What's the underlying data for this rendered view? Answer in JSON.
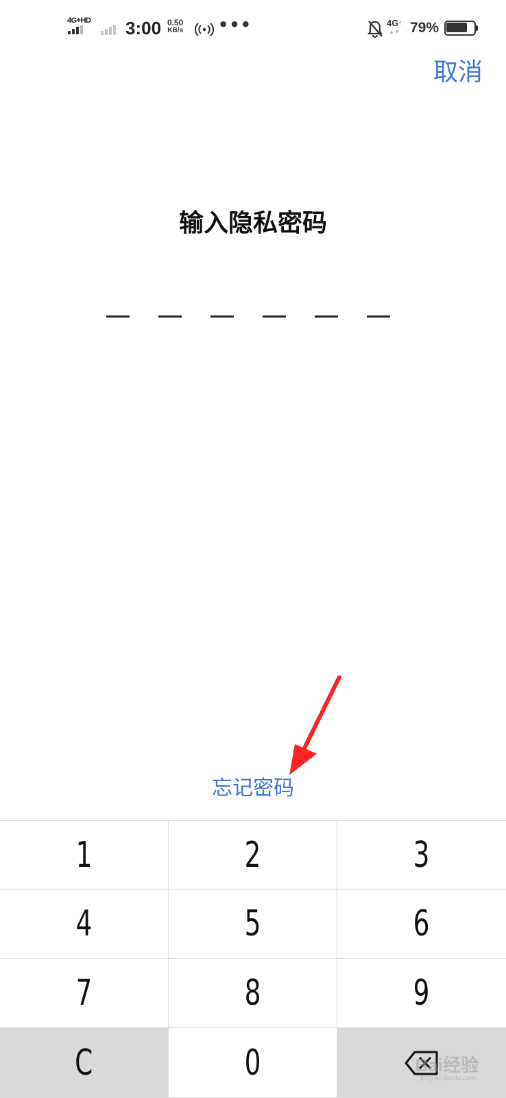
{
  "status_bar": {
    "network_label": "4G+HD",
    "time": "3:00",
    "speed_value": "0.50",
    "speed_unit": "KB/s",
    "more": "•••",
    "network2": "4G",
    "battery_percent": "79%",
    "battery_level": 0.79,
    "icons": [
      "signal-icon",
      "signal-weak-icon",
      "hotspot-icon",
      "mute-icon",
      "battery-icon"
    ]
  },
  "header": {
    "cancel_label": "取消"
  },
  "main": {
    "title": "输入隐私密码",
    "pin_length": 6,
    "forgot_label": "忘记密码"
  },
  "keypad": {
    "keys": [
      "1",
      "2",
      "3",
      "4",
      "5",
      "6",
      "7",
      "8",
      "9",
      "C",
      "0"
    ],
    "backspace_icon": "backspace-icon"
  },
  "watermark": {
    "brand": "Bai经验",
    "url": "jingyan.baidu.com"
  },
  "colors": {
    "accent": "#3f77cf",
    "annotation_arrow": "#ff2222",
    "function_key_bg": "#d9d9d9"
  }
}
